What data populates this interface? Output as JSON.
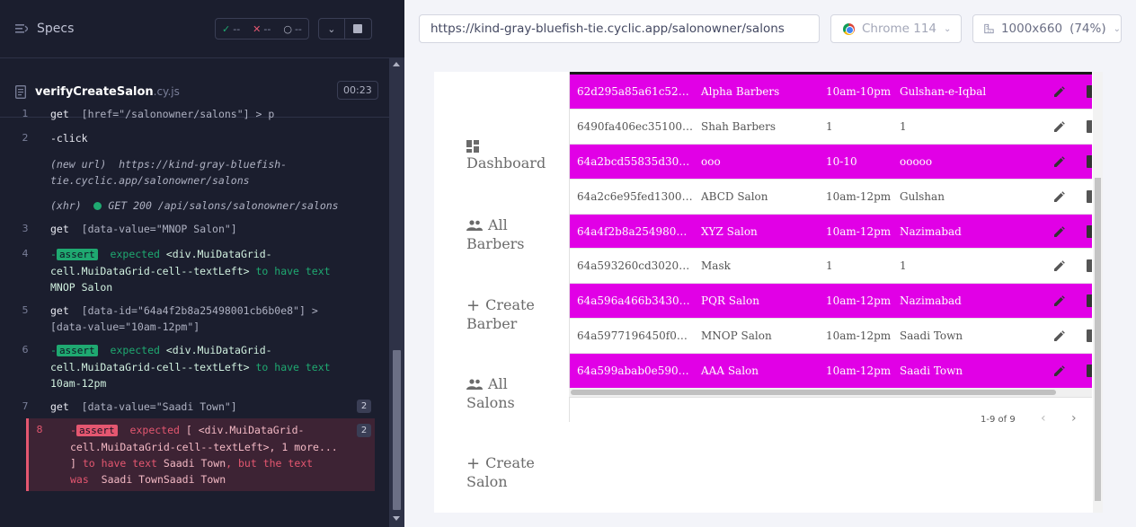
{
  "reporter": {
    "specs_label": "Specs",
    "passed": "--",
    "failed": "--",
    "pending": "--",
    "spec_name": "verifyCreateSalon",
    "spec_ext": ".cy.js",
    "duration": "00:23"
  },
  "commands": [
    {
      "num": "1",
      "name": "get",
      "arg": "[href=\"/salonowner/salons\"] > p"
    },
    {
      "num": "2",
      "name": "-click"
    },
    {
      "num": "",
      "sub": "(new url)",
      "url_line1": "https://kind-gray-bluefish-",
      "url_line2": "tie.cyclic.app/salonowner/salons"
    },
    {
      "num": "",
      "sub": "(xhr)",
      "xhr": "GET 200 /api/salons/salonowner/salons"
    },
    {
      "num": "3",
      "name": "get",
      "arg": "[data-value=\"MNOP Salon\"]"
    },
    {
      "num": "4",
      "prefix": "-",
      "badge": "assert",
      "l1": "expected",
      "l1b": "<div.MuiDataGrid-",
      "l2": "cell.MuiDataGrid-cell--textLeft>",
      "l2b": "to have text",
      "l3": "MNOP Salon"
    },
    {
      "num": "5",
      "name": "get",
      "arg": "[data-id=\"64a4f2b8a25498001cb6b0e8\"] >",
      "arg2": "[data-value=\"10am-12pm\"]"
    },
    {
      "num": "6",
      "prefix": "-",
      "badge": "assert",
      "l1": "expected",
      "l1b": "<div.MuiDataGrid-",
      "l2": "cell.MuiDataGrid-cell--textLeft>",
      "l2b": "to have text",
      "l3": "10am-12pm"
    },
    {
      "num": "7",
      "name": "get",
      "arg": "[data-value=\"Saadi Town\"]",
      "count": "2"
    },
    {
      "num": "8",
      "prefix": "-",
      "badge": "assert",
      "l1": "expected",
      "l1b": "[ <div.MuiDataGrid-",
      "l2": "cell.MuiDataGrid-cell--textLeft>, 1 more...",
      "l3a": "]",
      "l3b": "to have text",
      "l3c": "Saadi Town",
      "l3d": ", but the text",
      "l4a": "was",
      "l4b": "Saadi TownSaadi Town",
      "count": "2"
    }
  ],
  "url": "https://kind-gray-bluefish-tie.cyclic.app/salonowner/salons",
  "browser": "Chrome 114",
  "viewport": "1000x660",
  "viewport_scale": "(74%)",
  "nav": {
    "dashboard": "Dashboard",
    "all_barbers_1": "All",
    "all_barbers_2": "Barbers",
    "create_barber_1": "Create",
    "create_barber_2": "Barber",
    "all_salons_1": "All",
    "all_salons_2": "Salons",
    "create_salon_1": "Create",
    "create_salon_2": "Salon"
  },
  "rows": [
    {
      "id": "62d295a85a61c523c0...",
      "name": "Alpha Barbers",
      "hours": "10am-10pm",
      "area": "Gulshan-e-Iqbal",
      "hl": true
    },
    {
      "id": "6490fa406ec351001c4...",
      "name": "Shah Barbers",
      "hours": "1",
      "area": "1",
      "hl": false
    },
    {
      "id": "64a2bcd55835d3001d...",
      "name": "ooo",
      "hours": "10-10",
      "area": "ooooo",
      "hl": true
    },
    {
      "id": "64a2c6e95fed1300337...",
      "name": "ABCD Salon",
      "hours": "10am-12pm",
      "area": "Gulshan",
      "hl": false
    },
    {
      "id": "64a4f2b8a25498001cb...",
      "name": "XYZ Salon",
      "hours": "10am-12pm",
      "area": "Nazimabad",
      "hl": true
    },
    {
      "id": "64a593260cd302001d...",
      "name": "Mask",
      "hours": "1",
      "area": "1",
      "hl": false
    },
    {
      "id": "64a596a466b3430033...",
      "name": "PQR Salon",
      "hours": "10am-12pm",
      "area": "Nazimabad",
      "hl": true
    },
    {
      "id": "64a5977196450f001d...",
      "name": "MNOP Salon",
      "hours": "10am-12pm",
      "area": "Saadi Town",
      "hl": false
    },
    {
      "id": "64a599abab0e59001d...",
      "name": "AAA Salon",
      "hours": "10am-12pm",
      "area": "Saadi Town",
      "hl": true
    }
  ],
  "pagination": "1-9 of 9",
  "colors": {
    "highlight": "#e100e6",
    "pass": "#1fa971",
    "fail": "#e45770"
  }
}
